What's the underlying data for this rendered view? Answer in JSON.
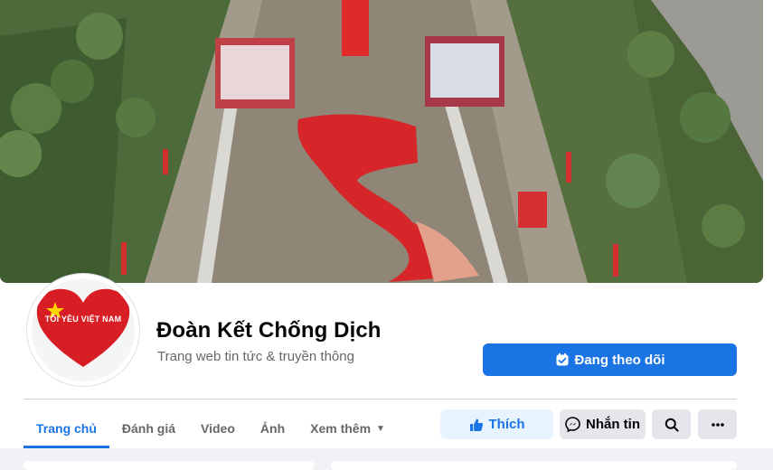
{
  "page": {
    "name": "Đoàn Kết Chống Dịch",
    "category": "Trang web tin tức & truyền thông",
    "avatar_text": "TÔI YÊU VIỆT NAM"
  },
  "actions": {
    "follow_label": "Đang theo dõi",
    "like_label": "Thích",
    "message_label": "Nhắn tin"
  },
  "tabs": [
    {
      "label": "Trang chủ",
      "active": true
    },
    {
      "label": "Đánh giá"
    },
    {
      "label": "Video"
    },
    {
      "label": "Ảnh"
    },
    {
      "label": "Xem thêm"
    }
  ],
  "icons": {
    "follow": "check-badge-icon",
    "like": "thumbs-up-icon",
    "message": "messenger-icon",
    "search": "search-icon",
    "more": "more-dots-icon",
    "dropdown": "caret-down-icon"
  },
  "colors": {
    "primary": "#1b74e4",
    "like_bg": "#e7f3ff",
    "secondary_bg": "#e4e6eb",
    "text": "#050505",
    "muted": "#65676b"
  }
}
